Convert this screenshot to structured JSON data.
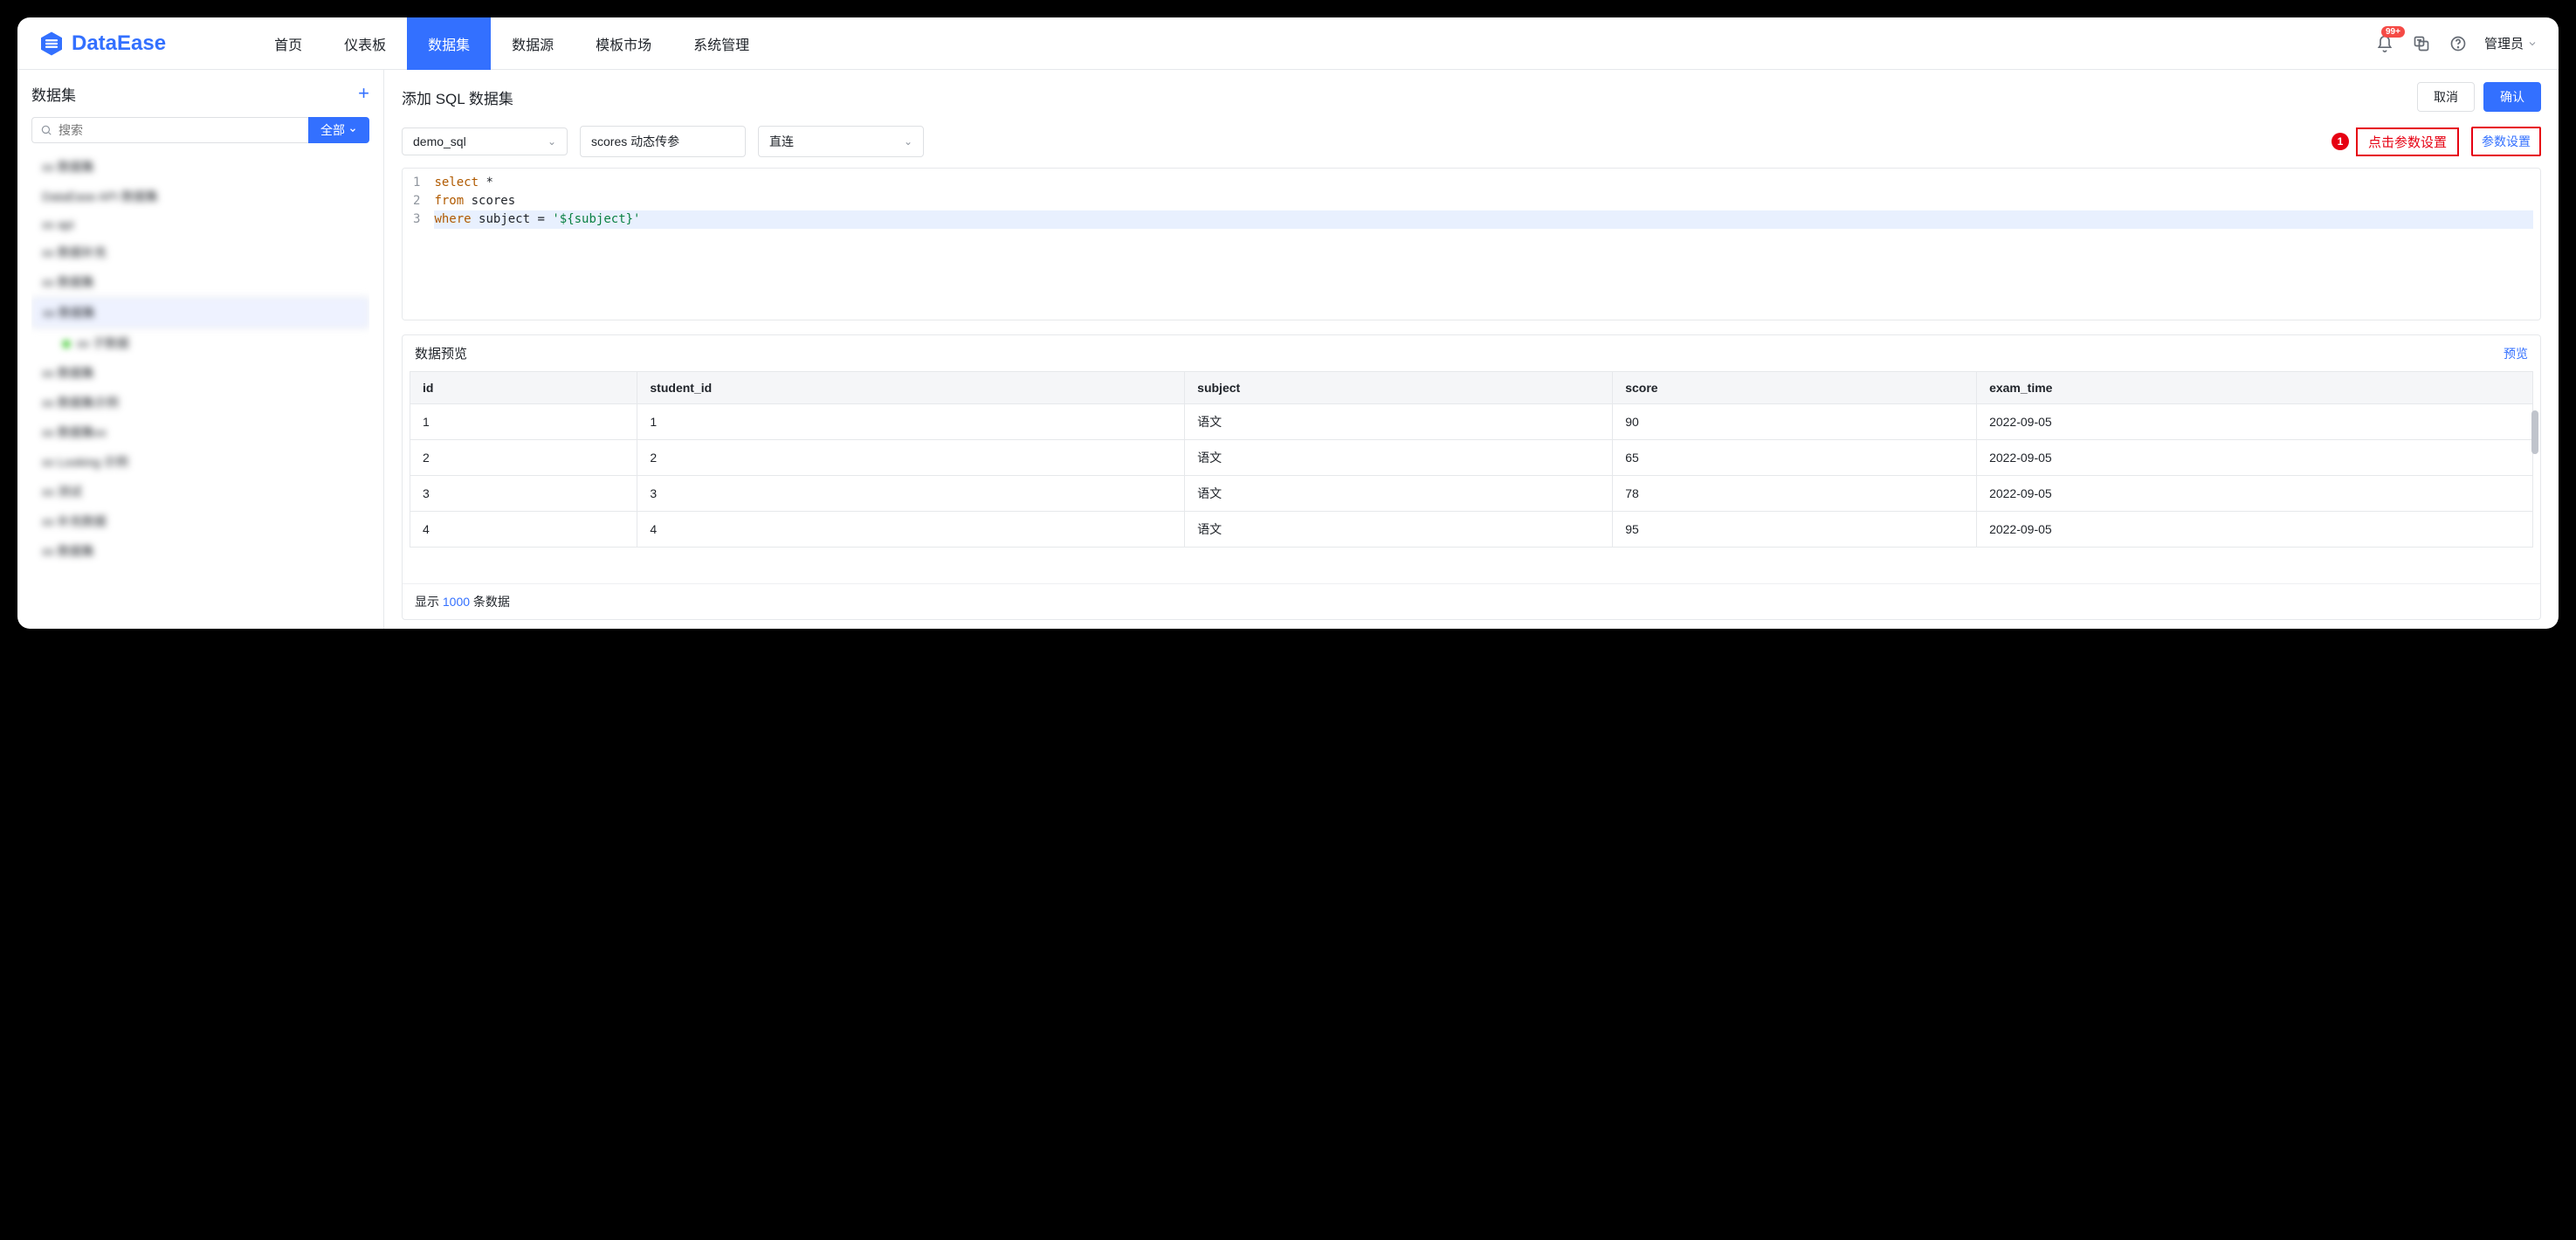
{
  "brand": "DataEase",
  "nav": [
    "首页",
    "仪表板",
    "数据集",
    "数据源",
    "模板市场",
    "系统管理"
  ],
  "nav_active": 2,
  "badge": "99+",
  "user": "管理员",
  "sidebar": {
    "title": "数据集",
    "search_placeholder": "搜索",
    "filter_label": "全部",
    "items": [
      {
        "label": "xx 数据集",
        "sel": false
      },
      {
        "label": "DataEase API 数据集",
        "sel": false
      },
      {
        "label": "xx api",
        "sel": false
      },
      {
        "label": "xx 数据补充",
        "sel": false
      },
      {
        "label": "xx 数据集",
        "sel": false
      },
      {
        "label": "xx 数据集",
        "sel": true
      },
      {
        "label": "xx 子数据",
        "sel": false,
        "child": true,
        "dot": true
      },
      {
        "label": "xx 数据集",
        "sel": false
      },
      {
        "label": "xx 数据集示例",
        "sel": false
      },
      {
        "label": "xx 数据集xx",
        "sel": false
      },
      {
        "label": "xx Looking 示例",
        "sel": false
      },
      {
        "label": "xx 测试",
        "sel": false
      },
      {
        "label": "xx 补充数据",
        "sel": false
      },
      {
        "label": "xx 数据集",
        "sel": false
      }
    ]
  },
  "main": {
    "title": "添加 SQL 数据集",
    "cancel": "取消",
    "confirm": "确认",
    "source_sel": "demo_sql",
    "name_sel": "scores 动态传参",
    "mode_sel": "直连",
    "annot_num": "1",
    "annot_text": "点击参数设置",
    "param_btn": "参数设置",
    "code": [
      [
        {
          "t": "select",
          "c": "kw"
        },
        {
          "t": " ",
          "c": ""
        },
        {
          "t": "*",
          "c": "punc"
        }
      ],
      [
        {
          "t": "from",
          "c": "kw"
        },
        {
          "t": " ",
          "c": ""
        },
        {
          "t": "scores",
          "c": "ident"
        }
      ],
      [
        {
          "t": "where",
          "c": "kw"
        },
        {
          "t": " ",
          "c": ""
        },
        {
          "t": "subject",
          "c": "ident"
        },
        {
          "t": " = ",
          "c": "punc"
        },
        {
          "t": "'${subject}'",
          "c": "str"
        }
      ]
    ],
    "preview_title": "数据预览",
    "preview_link": "预览",
    "columns": [
      "id",
      "student_id",
      "subject",
      "score",
      "exam_time"
    ],
    "rows": [
      [
        "1",
        "1",
        "语文",
        "90",
        "2022-09-05"
      ],
      [
        "2",
        "2",
        "语文",
        "65",
        "2022-09-05"
      ],
      [
        "3",
        "3",
        "语文",
        "78",
        "2022-09-05"
      ],
      [
        "4",
        "4",
        "语文",
        "95",
        "2022-09-05"
      ]
    ],
    "footer_prefix": "显示 ",
    "footer_count": "1000",
    "footer_suffix": " 条数据"
  }
}
